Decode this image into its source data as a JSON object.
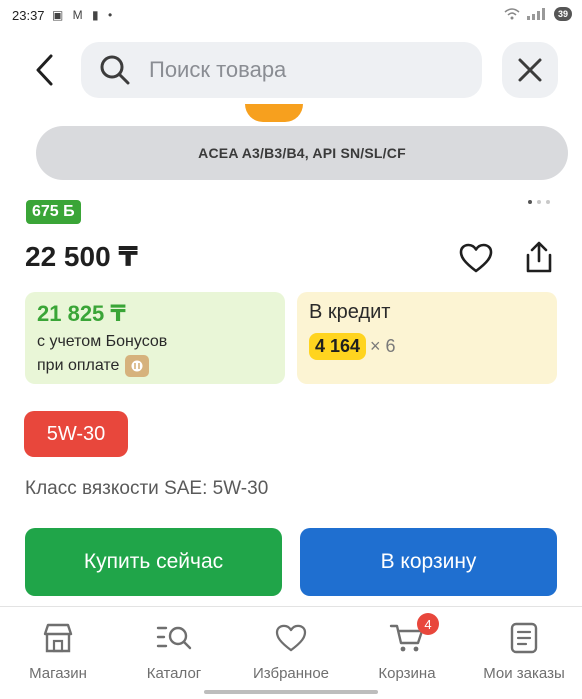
{
  "status_bar": {
    "time": "23:37",
    "battery": "39"
  },
  "search": {
    "placeholder": "Поиск товара"
  },
  "product": {
    "spec": "ACEA A3/B3/B4, API SN/SL/CF",
    "bonus_badge": "675 Б",
    "price": "22 500 ₸",
    "bonus_price": {
      "amount": "21 825 ₸",
      "line1": "с учетом Бонусов",
      "line2": "при оплате"
    },
    "credit": {
      "title": "В кредит",
      "amount": "4 164",
      "multiplier": "× 6"
    },
    "variant": "5W-30",
    "viscosity": "Класс вязкости SAE: 5W-30"
  },
  "image_pager": {
    "count": 3,
    "active_index": 0
  },
  "actions": {
    "buy_now": "Купить сейчас",
    "add_to_cart": "В корзину"
  },
  "bottom_nav": {
    "items": [
      {
        "label": "Магазин",
        "icon": "store-icon"
      },
      {
        "label": "Каталог",
        "icon": "catalog-search-icon"
      },
      {
        "label": "Избранное",
        "icon": "heart-icon"
      },
      {
        "label": "Корзина",
        "icon": "cart-icon",
        "badge": "4"
      },
      {
        "label": "Мои заказы",
        "icon": "orders-icon"
      }
    ]
  },
  "colors": {
    "green": "#20a549",
    "blue": "#1f6fd0",
    "red": "#e8473c",
    "yellow": "#ffd41f"
  }
}
